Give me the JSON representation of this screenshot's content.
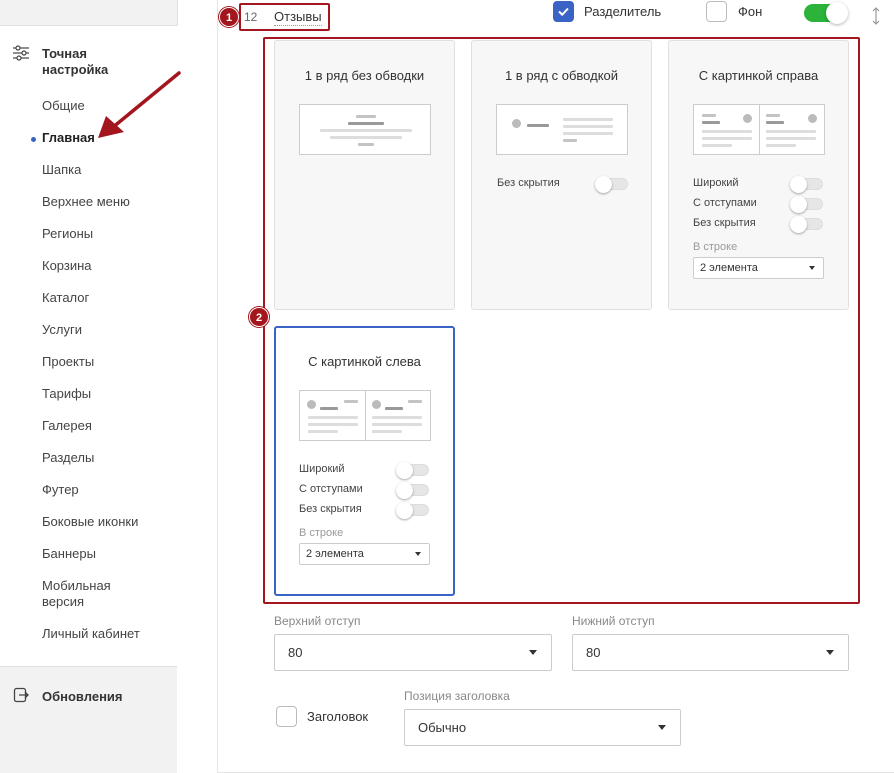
{
  "sidebar": {
    "section_title": "Точная настройка",
    "items": [
      {
        "label": "Общие"
      },
      {
        "label": "Главная"
      },
      {
        "label": "Шапка"
      },
      {
        "label": "Верхнее меню"
      },
      {
        "label": "Регионы"
      },
      {
        "label": "Корзина"
      },
      {
        "label": "Каталог"
      },
      {
        "label": "Услуги"
      },
      {
        "label": "Проекты"
      },
      {
        "label": "Тарифы"
      },
      {
        "label": "Галерея"
      },
      {
        "label": "Разделы"
      },
      {
        "label": "Футер"
      },
      {
        "label": "Боковые иконки"
      },
      {
        "label": "Баннеры"
      },
      {
        "label": "Мобильная версия"
      },
      {
        "label": "Личный кабинет"
      }
    ],
    "active_item": "Главная",
    "updates_label": "Обновления"
  },
  "header": {
    "badge_1": "1",
    "block_number": "12",
    "block_name": "Отзывы",
    "divider_label": "Разделитель",
    "divider_checked": true,
    "background_label": "Фон",
    "background_checked": false,
    "block_enabled": true
  },
  "templates": {
    "badge_2": "2",
    "cards": [
      {
        "title": "1 в ряд без обводки",
        "selected": false
      },
      {
        "title": "1 в ряд с обводкой",
        "selected": false,
        "options": {
          "no_hide": "Без скрытия"
        }
      },
      {
        "title": "С картинкой справа",
        "selected": false,
        "options": {
          "wide": "Широкий",
          "padded": "С отступами",
          "no_hide": "Без скрытия",
          "per_row_label": "В строке",
          "per_row_value": "2 элемента"
        }
      },
      {
        "title": "С картинкой слева",
        "selected": true,
        "options": {
          "wide": "Широкий",
          "padded": "С отступами",
          "no_hide": "Без скрытия",
          "per_row_label": "В строке",
          "per_row_value": "2 элемента"
        }
      }
    ]
  },
  "form": {
    "top_margin_label": "Верхний отступ",
    "top_margin_value": "80",
    "bottom_margin_label": "Нижний отступ",
    "bottom_margin_value": "80",
    "heading_label": "Заголовок",
    "heading_checked": false,
    "heading_position_label": "Позиция заголовка",
    "heading_position_value": "Обычно"
  },
  "colors": {
    "accent_blue": "#3a63c6",
    "annotation_red": "#a3161d",
    "toggle_green": "#2cb33a"
  }
}
